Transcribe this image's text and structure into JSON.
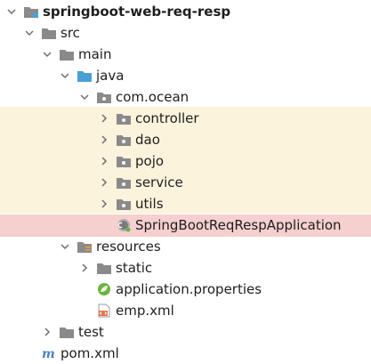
{
  "colors": {
    "package_highlight": "#fbf3dc",
    "selected_highlight": "#f6cfcf",
    "folder": "#8a8a8a",
    "source_folder": "#4b9fd5",
    "spring": "#6db33f"
  },
  "tree": {
    "project": "springboot-web-req-resp",
    "src": "src",
    "main": "main",
    "java": "java",
    "package": "com.ocean",
    "packages": [
      "controller",
      "dao",
      "pojo",
      "service",
      "utils"
    ],
    "app_class": "SpringBootReqRespApplication",
    "resources": "resources",
    "static": "static",
    "app_properties": "application.properties",
    "emp_xml": "emp.xml",
    "test": "test",
    "pom": "pom.xml"
  }
}
